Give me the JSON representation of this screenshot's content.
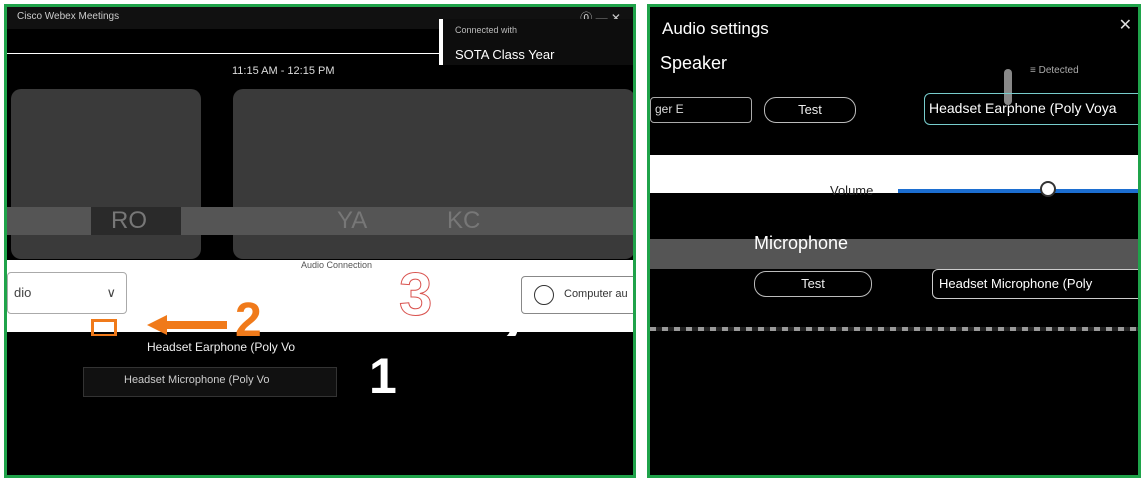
{
  "left": {
    "titlebar": {
      "app_name": "Cisco Webex Meetings",
      "org": "Connected with ",
      "controls": "⓪ —  ✕"
    },
    "meeting_card": {
      "title": "SOTA Class Year"
    },
    "time": "11:15 AM - 12:15 PM",
    "audio_dropdown": {
      "value": "dio",
      "chevron": "∨"
    },
    "audio_connection_label": "Audio Connection",
    "computer_audio_label": "Computer au",
    "speaker_selected": "Headset Earphone (Poly Vo",
    "mic_selected": "Headset Microphone (Poly Vo",
    "annotations": {
      "n1": "1",
      "n2": "2",
      "n2b": "2",
      "n3": "3"
    },
    "overlay_glyphs": [
      "RO",
      "YA",
      "KC"
    ]
  },
  "right": {
    "title": "Audio settings",
    "close": "✕",
    "speaker_label": "Speaker",
    "status": "≡ Detected",
    "speaker_left_dd": "ger E",
    "test_label": "Test",
    "speaker_device": "Headset Earphone (Poly Voya",
    "volume_label": "Volume",
    "microphone_label": "Microphone",
    "test2_label": "Test",
    "mic_device": "Headset Microphone (Poly"
  },
  "colors": {
    "border": "#1fa34a",
    "annotation_orange": "#f07a1a",
    "annotation_red": "#d9534f",
    "slider": "#1c6ed0"
  }
}
